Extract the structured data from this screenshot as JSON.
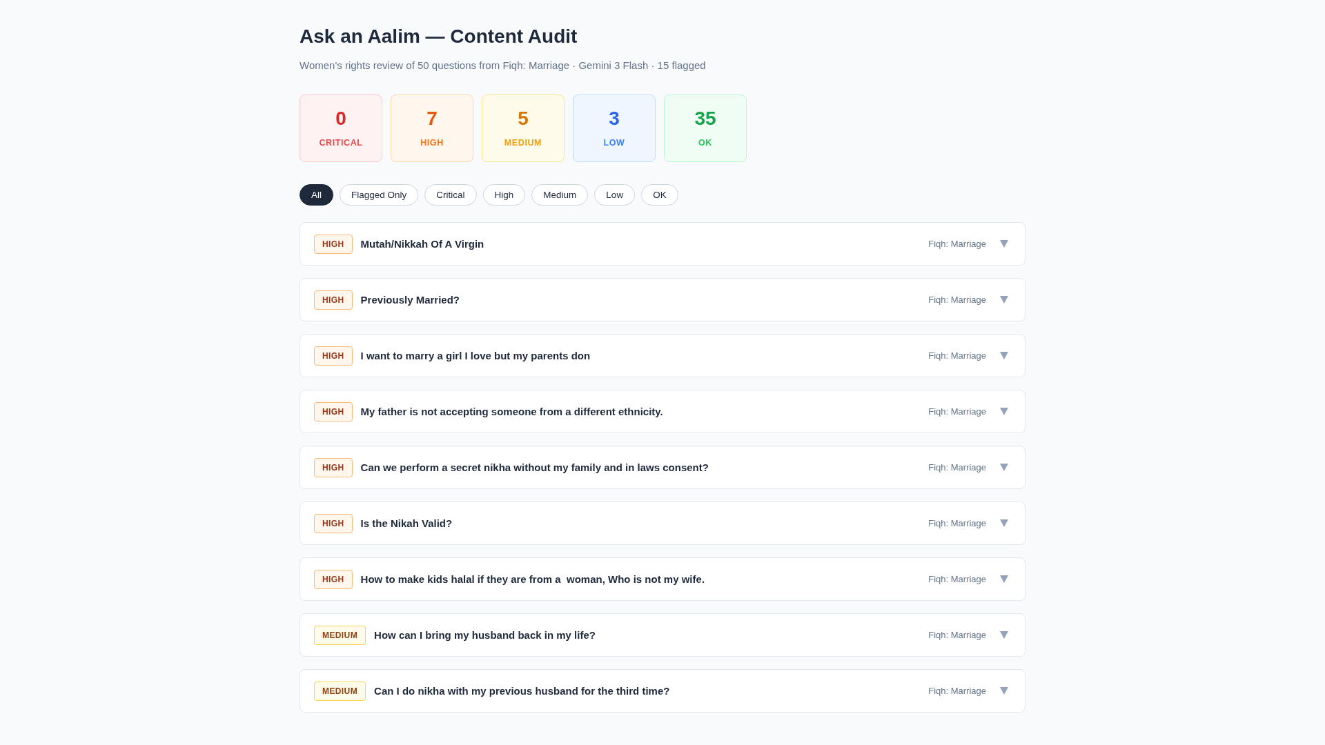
{
  "header": {
    "title": "Ask an Aalim — Content Audit",
    "subtitle": "Women's rights review of 50 questions from Fiqh: Marriage · Gemini 3 Flash · 15 flagged"
  },
  "stats": [
    {
      "kind": "critical",
      "count": "0",
      "label": "CRITICAL"
    },
    {
      "kind": "high",
      "count": "7",
      "label": "HIGH"
    },
    {
      "kind": "medium",
      "count": "5",
      "label": "MEDIUM"
    },
    {
      "kind": "low",
      "count": "3",
      "label": "LOW"
    },
    {
      "kind": "ok",
      "count": "35",
      "label": "OK"
    }
  ],
  "filters": [
    {
      "label": "All",
      "selected": true
    },
    {
      "label": "Flagged Only",
      "selected": false
    },
    {
      "label": "Critical",
      "selected": false
    },
    {
      "label": "High",
      "selected": false
    },
    {
      "label": "Medium",
      "selected": false
    },
    {
      "label": "Low",
      "selected": false
    },
    {
      "label": "OK",
      "selected": false
    }
  ],
  "questions": [
    {
      "kind": "high",
      "badge": "HIGH",
      "title": "Mutah/Nikkah Of A Virgin",
      "category": "Fiqh: Marriage"
    },
    {
      "kind": "high",
      "badge": "HIGH",
      "title": "Previously Married?",
      "category": "Fiqh: Marriage"
    },
    {
      "kind": "high",
      "badge": "HIGH",
      "title": "I want to marry a girl I love but my parents don",
      "category": "Fiqh: Marriage"
    },
    {
      "kind": "high",
      "badge": "HIGH",
      "title": "My father is not accepting someone from a different ethnicity.",
      "category": "Fiqh: Marriage"
    },
    {
      "kind": "high",
      "badge": "HIGH",
      "title": "Can we perform a secret nikha without my family and in laws consent?",
      "category": "Fiqh: Marriage"
    },
    {
      "kind": "high",
      "badge": "HIGH",
      "title": "Is the Nikah Valid?",
      "category": "Fiqh: Marriage"
    },
    {
      "kind": "high",
      "badge": "HIGH",
      "title": "How to make kids halal if they are from a  woman, Who is not my wife.",
      "category": "Fiqh: Marriage"
    },
    {
      "kind": "medium",
      "badge": "MEDIUM",
      "title": "How can I bring my husband back in my life?",
      "category": "Fiqh: Marriage"
    },
    {
      "kind": "medium",
      "badge": "MEDIUM",
      "title": "Can I do nikha with my previous husband for the third time?",
      "category": "Fiqh: Marriage"
    }
  ]
}
